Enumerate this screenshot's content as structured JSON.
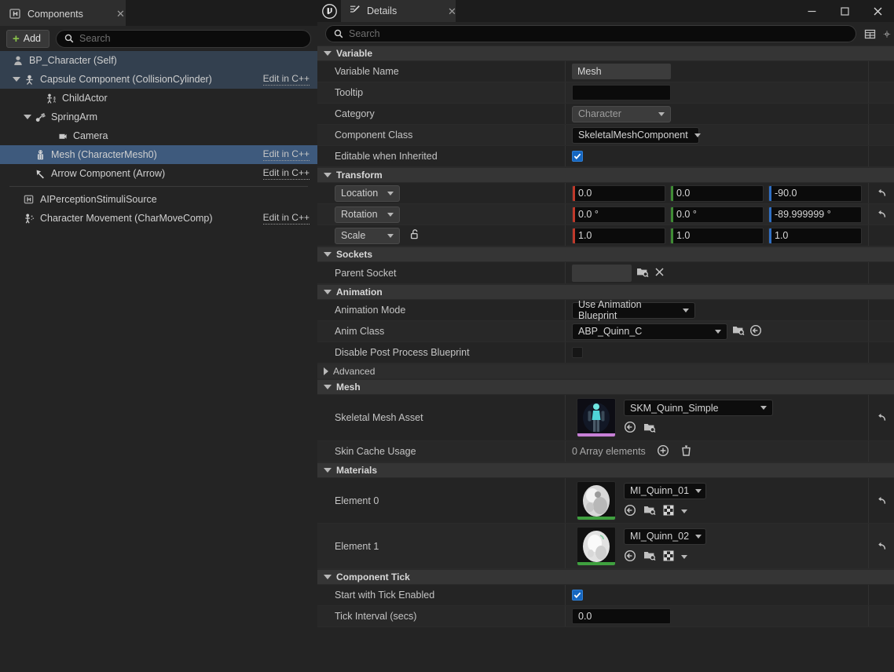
{
  "components_panel": {
    "tab_label": "Components",
    "tab_icon": "blueprint-icon",
    "close_icon": "close-icon",
    "add_button_label": "Add",
    "search_placeholder": "Search",
    "edit_in_cpp_label": "Edit in C++",
    "tree": [
      {
        "label": "BP_Character (Self)",
        "icon": "character-icon",
        "indent": 0,
        "twisty": "none",
        "selected": "root",
        "edit_cpp": false
      },
      {
        "label": "Capsule Component (CollisionCylinder)",
        "icon": "capsule-icon",
        "indent": 1,
        "twisty": "down",
        "selected": "root",
        "edit_cpp": true
      },
      {
        "label": "ChildActor",
        "icon": "child-actor-icon",
        "indent": 2,
        "twisty": "none",
        "selected": "none",
        "edit_cpp": false
      },
      {
        "label": "SpringArm",
        "icon": "spring-arm-icon",
        "indent": 2,
        "twisty": "down",
        "selected": "none",
        "edit_cpp": false
      },
      {
        "label": "Camera",
        "icon": "camera-icon",
        "indent": 3,
        "twisty": "none",
        "selected": "none",
        "edit_cpp": false
      },
      {
        "label": "Mesh (CharacterMesh0)",
        "icon": "skeletal-mesh-icon",
        "indent": 2,
        "twisty": "none",
        "selected": "blue",
        "edit_cpp": true
      },
      {
        "label": "Arrow Component (Arrow)",
        "icon": "arrow-icon",
        "indent": 2,
        "twisty": "none",
        "selected": "none",
        "edit_cpp": true
      }
    ],
    "tree_bottom": [
      {
        "label": "AIPerceptionStimuliSource",
        "icon": "blueprint-icon",
        "indent": 1,
        "twisty": "none",
        "edit_cpp": false
      },
      {
        "label": "Character Movement (CharMoveComp)",
        "icon": "char-movement-icon",
        "indent": 1,
        "twisty": "none",
        "edit_cpp": true
      }
    ]
  },
  "details_panel": {
    "app_logo": "unreal-engine-logo",
    "tab_label": "Details",
    "tab_icon": "details-icon",
    "close_icon": "close-icon",
    "window_controls": {
      "minimize": "minimize-icon",
      "maximize": "maximize-icon",
      "close": "close-icon"
    },
    "search_placeholder": "Search",
    "toolbar_icons": [
      "column-settings-icon",
      "settings-icon"
    ],
    "sections": [
      {
        "title": "Variable",
        "expanded": true,
        "rows": [
          {
            "name": "Variable Name",
            "type": "text",
            "value": "Mesh",
            "field_style": "gray",
            "reset": false
          },
          {
            "name": "Tooltip",
            "type": "text",
            "value": "",
            "field_style": "dark",
            "reset": false
          },
          {
            "name": "Category",
            "type": "combo-gray",
            "value": "Character",
            "reset": false
          },
          {
            "name": "Component Class",
            "type": "combo",
            "value": "SkeletalMeshComponent",
            "reset": false
          },
          {
            "name": "Editable when Inherited",
            "type": "checkbox",
            "value": true,
            "reset": false
          }
        ]
      },
      {
        "title": "Transform",
        "expanded": true,
        "rows": [
          {
            "name": "Location",
            "type": "vector",
            "dropdown": true,
            "lock": false,
            "values": [
              "0.0",
              "0.0",
              "-90.0"
            ],
            "reset": true
          },
          {
            "name": "Rotation",
            "type": "vector",
            "dropdown": true,
            "lock": false,
            "values": [
              "0.0 °",
              "0.0 °",
              "-89.999999 °"
            ],
            "reset": true
          },
          {
            "name": "Scale",
            "type": "vector",
            "dropdown": true,
            "lock": true,
            "lock_icon": "unlock-icon",
            "values": [
              "1.0",
              "1.0",
              "1.0"
            ],
            "reset": false
          }
        ]
      },
      {
        "title": "Sockets",
        "expanded": true,
        "rows": [
          {
            "name": "Parent Socket",
            "type": "socket",
            "value": "",
            "icons": [
              "browse-icon",
              "clear-x-icon"
            ],
            "reset": false
          }
        ]
      },
      {
        "title": "Animation",
        "expanded": true,
        "rows": [
          {
            "name": "Animation Mode",
            "type": "combo",
            "value": "Use Animation Blueprint",
            "width": 156,
            "reset": false
          },
          {
            "name": "Anim Class",
            "type": "combo",
            "value": "ABP_Quinn_C",
            "width": 198,
            "icons": [
              "browse-icon",
              "back-arrow-icon"
            ],
            "reset": false
          },
          {
            "name": "Disable Post Process Blueprint",
            "type": "checkbox",
            "value": false,
            "reset": false
          }
        ]
      },
      {
        "title": "Advanced",
        "expanded": false,
        "rows": []
      },
      {
        "title": "Mesh",
        "expanded": true,
        "rows": [
          {
            "name": "Skeletal Mesh Asset",
            "type": "asset",
            "value": "SKM_Quinn_Simple",
            "thumbnail": "skeletal-mesh-thumbnail",
            "thumb_bar_color": "#c77fd6",
            "icons": [
              "back-arrow-icon",
              "browse-icon"
            ],
            "reset": true
          },
          {
            "name": "Skin Cache Usage",
            "type": "array",
            "value": "0 Array elements",
            "icons": [
              "add-element-icon",
              "delete-icon"
            ],
            "reset": false
          }
        ]
      },
      {
        "title": "Materials",
        "expanded": true,
        "rows": [
          {
            "name": "Element 0",
            "type": "asset",
            "value": "MI_Quinn_01",
            "thumbnail": "material-sphere-thumbnail",
            "thumb_bar_color": "#3fa03f",
            "icons": [
              "back-arrow-icon",
              "browse-icon",
              "checker-icon",
              "chevron-down-icon"
            ],
            "reset": true
          },
          {
            "name": "Element 1",
            "type": "asset",
            "value": "MI_Quinn_02",
            "thumbnail": "material-sphere-thumbnail",
            "thumb_bar_color": "#3fa03f",
            "icons": [
              "back-arrow-icon",
              "browse-icon",
              "checker-icon",
              "chevron-down-icon"
            ],
            "reset": true
          }
        ]
      },
      {
        "title": "Component Tick",
        "expanded": true,
        "rows": [
          {
            "name": "Start with Tick Enabled",
            "type": "checkbox",
            "value": true,
            "reset": false
          },
          {
            "name": "Tick Interval (secs)",
            "type": "text",
            "value": "0.0",
            "field_style": "dark",
            "reset": false
          }
        ]
      }
    ]
  },
  "colors": {
    "panel_bg": "#242424",
    "row_alt": "#282828",
    "section_header": "#353535",
    "selection_blue": "#3e5a7d",
    "selection_root": "#33404f",
    "accent_green": "#8ac34a",
    "checkbox_blue": "#1566c0",
    "axis_x": "#c0392b",
    "axis_y": "#3f8c34",
    "axis_z": "#2f6fc4"
  }
}
